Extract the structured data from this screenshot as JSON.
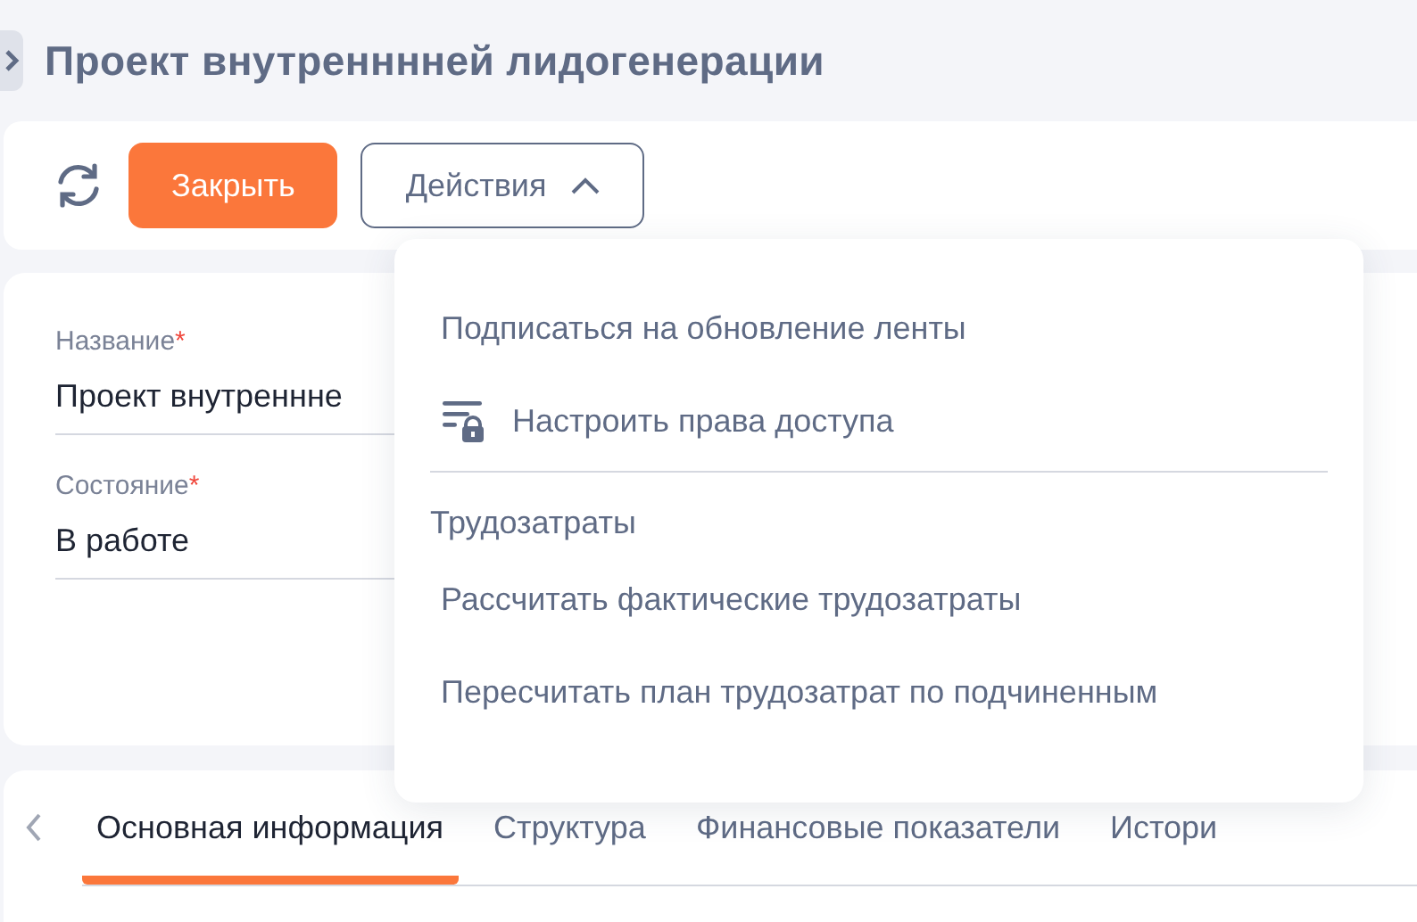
{
  "title": "Проект внутренннней лидогенерации",
  "toolbar": {
    "close_button": "Закрыть",
    "actions_button": {
      "label": "Действия",
      "expanded": true
    }
  },
  "fields": [
    {
      "label": "Название",
      "required_mark": "*",
      "value": "Проект внутреннне"
    },
    {
      "label": "Состояние",
      "required_mark": "*",
      "value": "В работе"
    }
  ],
  "actions_menu": [
    {
      "kind": "item",
      "label": "Подписаться на обновление ленты"
    },
    {
      "kind": "icon_item",
      "label": "Настроить права доступа"
    },
    {
      "kind": "divider"
    },
    {
      "kind": "header",
      "label": "Трудозатраты"
    },
    {
      "kind": "item",
      "label": "Рассчитать фактические трудозатраты"
    },
    {
      "kind": "item",
      "label": "Пересчитать план трудозатрат по подчиненным"
    }
  ],
  "tabs": [
    {
      "label": "Основная информация",
      "selected": true
    },
    {
      "label": "Структура",
      "selected": false
    },
    {
      "label": "Финансовые показатели",
      "selected": false
    },
    {
      "label": "Истори",
      "selected": false
    }
  ]
}
